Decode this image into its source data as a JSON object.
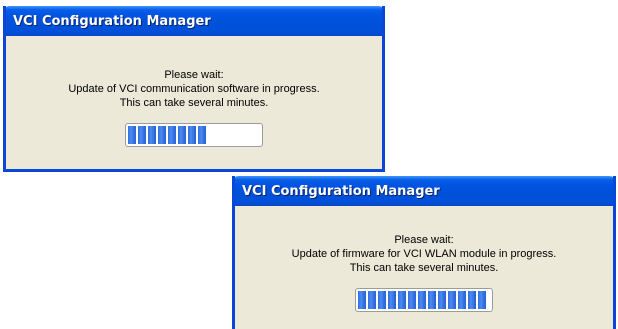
{
  "dialogs": [
    {
      "title": "VCI Configuration Manager",
      "message": {
        "line1": "Please wait:",
        "line2": "Update of VCI communication software in progress.",
        "line3": "This can take several minutes."
      },
      "progress_fraction": 0.6
    },
    {
      "title": "VCI Configuration Manager",
      "message": {
        "line1": "Please wait:",
        "line2": "Update of firmware for VCI WLAN module in progress.",
        "line3": "This can take several minutes."
      },
      "progress_fraction": 0.95
    }
  ],
  "colors": {
    "title_bar": "#0054e3",
    "window_body": "#ece9d8",
    "progress_block": "#2f6fe0"
  }
}
